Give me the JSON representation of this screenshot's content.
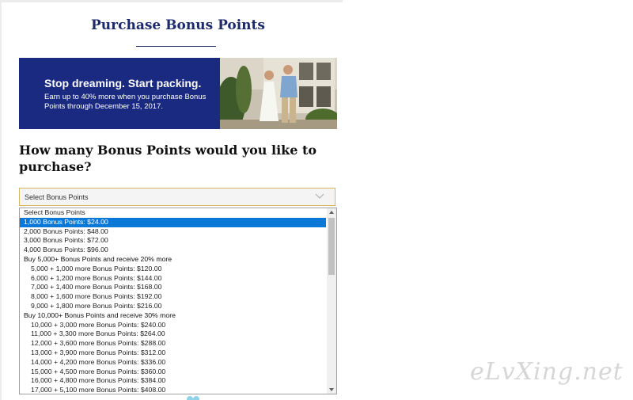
{
  "page": {
    "title": "Purchase Bonus Points"
  },
  "banner": {
    "headline": "Stop dreaming. Start packing.",
    "subtext": "Earn up to 40% more when you purchase Bonus Points through December 15, 2017."
  },
  "question": "How many Bonus Points would you like to purchase?",
  "select": {
    "value": "Select Bonus Points",
    "options": [
      {
        "label": "Select Bonus Points",
        "kind": "option"
      },
      {
        "label": "1,000 Bonus Points: $24.00",
        "kind": "option",
        "selected": true
      },
      {
        "label": "2,000 Bonus Points: $48.00",
        "kind": "option"
      },
      {
        "label": "3,000 Bonus Points: $72.00",
        "kind": "option"
      },
      {
        "label": "4,000 Bonus Points: $96.00",
        "kind": "option"
      },
      {
        "label": "Buy 5,000+ Bonus Points and receive 20% more",
        "kind": "group"
      },
      {
        "label": "5,000 + 1,000 more Bonus Points: $120.00",
        "kind": "indented"
      },
      {
        "label": "6,000 + 1,200 more Bonus Points: $144.00",
        "kind": "indented"
      },
      {
        "label": "7,000 + 1,400 more Bonus Points: $168.00",
        "kind": "indented"
      },
      {
        "label": "8,000 + 1,600 more Bonus Points: $192.00",
        "kind": "indented"
      },
      {
        "label": "9,000 + 1,800 more Bonus Points: $216.00",
        "kind": "indented"
      },
      {
        "label": "Buy 10,000+ Bonus Points and receive 30% more",
        "kind": "group"
      },
      {
        "label": "10,000 + 3,000 more Bonus Points: $240.00",
        "kind": "indented"
      },
      {
        "label": "11,000 + 3,300 more Bonus Points: $264.00",
        "kind": "indented"
      },
      {
        "label": "12,000 + 3,600 more Bonus Points: $288.00",
        "kind": "indented"
      },
      {
        "label": "13,000 + 3,900 more Bonus Points: $312.00",
        "kind": "indented"
      },
      {
        "label": "14,000 + 4,200 more Bonus Points: $336.00",
        "kind": "indented"
      },
      {
        "label": "15,000 + 4,500 more Bonus Points: $360.00",
        "kind": "indented"
      },
      {
        "label": "16,000 + 4,800 more Bonus Points: $384.00",
        "kind": "indented"
      },
      {
        "label": "17,000 + 5,100 more Bonus Points: $408.00",
        "kind": "indented"
      }
    ]
  },
  "watermark": "eLvXing.net",
  "colors": {
    "brand_navy": "#1d2a6b",
    "banner_blue": "#1a2a80",
    "select_border": "#d7b760",
    "highlight": "#0a78d7"
  },
  "icons": {
    "select_arrow": "chevron-down-icon"
  }
}
